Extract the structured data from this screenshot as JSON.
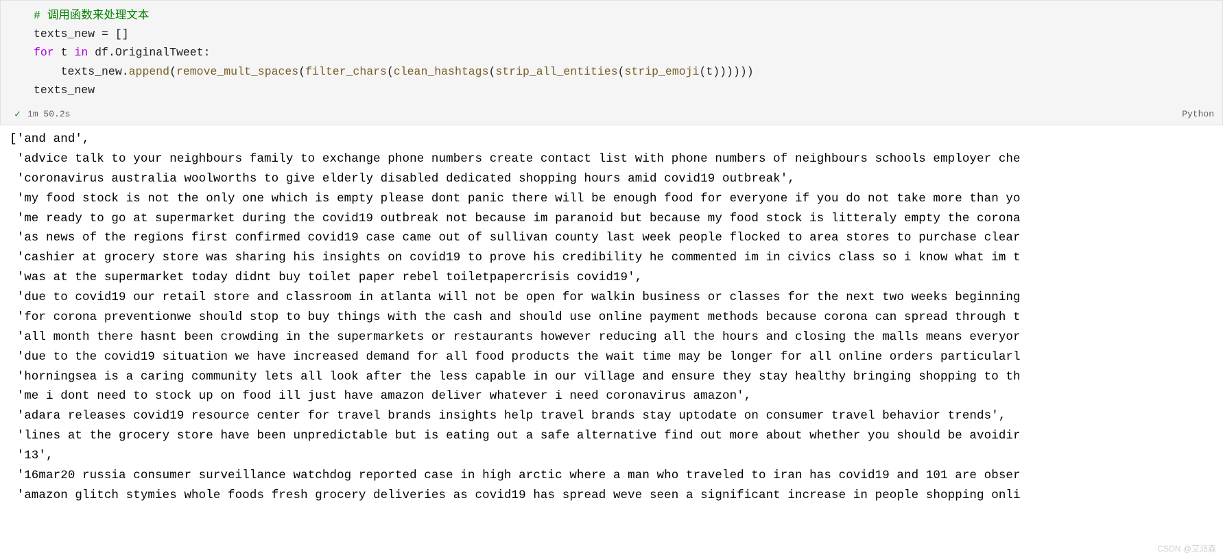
{
  "cell": {
    "code_lines": {
      "l1": {
        "hash": "# ",
        "comment": "调用函数来处理文本"
      },
      "l2": {
        "a": "texts_new ",
        "b": "=",
        "c": " []"
      },
      "l3": {
        "a": "for",
        "b": " t ",
        "c": "in",
        "d": " df",
        "e": ".",
        "f": "OriginalTweet",
        "g": ":"
      },
      "l4": {
        "indent": "    ",
        "a": "texts_new",
        "dot": ".",
        "append": "append",
        "p1": "(",
        "f1": "remove_mult_spaces",
        "p2": "(",
        "f2": "filter_chars",
        "p3": "(",
        "f3": "clean_hashtags",
        "p4": "(",
        "f4": "strip_all_entities",
        "p5": "(",
        "f5": "strip_emoji",
        "p6": "(",
        "t": "t",
        "p7": "))))))"
      },
      "l5": {
        "a": "texts_new"
      }
    },
    "status": {
      "time": "1m 50.2s",
      "lang": "Python"
    }
  },
  "output": {
    "lines": [
      "['and and',",
      " 'advice talk to your neighbours family to exchange phone numbers create contact list with phone numbers of neighbours schools employer che",
      " 'coronavirus australia woolworths to give elderly disabled dedicated shopping hours amid covid19 outbreak',",
      " 'my food stock is not the only one which is empty please dont panic there will be enough food for everyone if you do not take more than yo",
      " 'me ready to go at supermarket during the covid19 outbreak not because im paranoid but because my food stock is litteraly empty the corona",
      " 'as news of the regions first confirmed covid19 case came out of sullivan county last week people flocked to area stores to purchase clear",
      " 'cashier at grocery store was sharing his insights on covid19 to prove his credibility he commented im in civics class so i know what im t",
      " 'was at the supermarket today didnt buy toilet paper rebel toiletpapercrisis covid19',",
      " 'due to covid19 our retail store and classroom in atlanta will not be open for walkin business or classes for the next two weeks beginning",
      " 'for corona preventionwe should stop to buy things with the cash and should use online payment methods because corona can spread through t",
      " 'all month there hasnt been crowding in the supermarkets or restaurants however reducing all the hours and closing the malls means everyor",
      " 'due to the covid19 situation we have increased demand for all food products the wait time may be longer for all online orders particularl",
      " 'horningsea is a caring community lets all look after the less capable in our village and ensure they stay healthy bringing shopping to th",
      " 'me i dont need to stock up on food ill just have amazon deliver whatever i need coronavirus amazon',",
      " 'adara releases covid19 resource center for travel brands insights help travel brands stay uptodate on consumer travel behavior trends',",
      " 'lines at the grocery store have been unpredictable but is eating out a safe alternative find out more about whether you should be avoidir",
      " '13',",
      " '16mar20 russia consumer surveillance watchdog reported case in high arctic where a man who traveled to iran has covid19 and 101 are obser",
      " 'amazon glitch stymies whole foods fresh grocery deliveries as covid19 has spread weve seen a significant increase in people shopping onli"
    ]
  },
  "watermark": "CSDN @艾派森"
}
